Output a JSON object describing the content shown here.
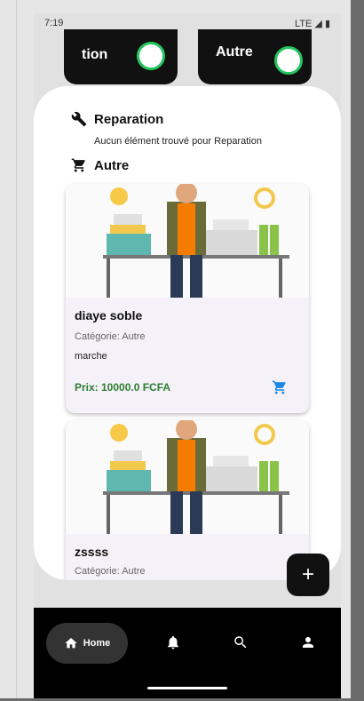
{
  "status_bar": {
    "time": "7:19",
    "network": "LTE"
  },
  "top_pills": [
    {
      "label": "tion"
    },
    {
      "label": "Autre"
    }
  ],
  "sections": [
    {
      "title": "Reparation",
      "icon": "wrench-icon",
      "empty_message": "Aucun élément trouvé pour Reparation"
    },
    {
      "title": "Autre",
      "icon": "cart-icon"
    }
  ],
  "items": [
    {
      "name": "diaye soble",
      "category": "Catégorie: Autre",
      "description": "marche",
      "price": "Prix: 10000.0 FCFA"
    },
    {
      "name": "zssss",
      "category": "Catégorie: Autre"
    }
  ],
  "fab": {
    "label": "+"
  },
  "bottom_nav": {
    "home_label": "Home",
    "icons": [
      "home-icon",
      "bell-icon",
      "search-icon",
      "person-icon"
    ]
  },
  "colors": {
    "accent_green": "#22c55e",
    "price_green": "#2e7d32",
    "cart_blue": "#1e88e5"
  }
}
